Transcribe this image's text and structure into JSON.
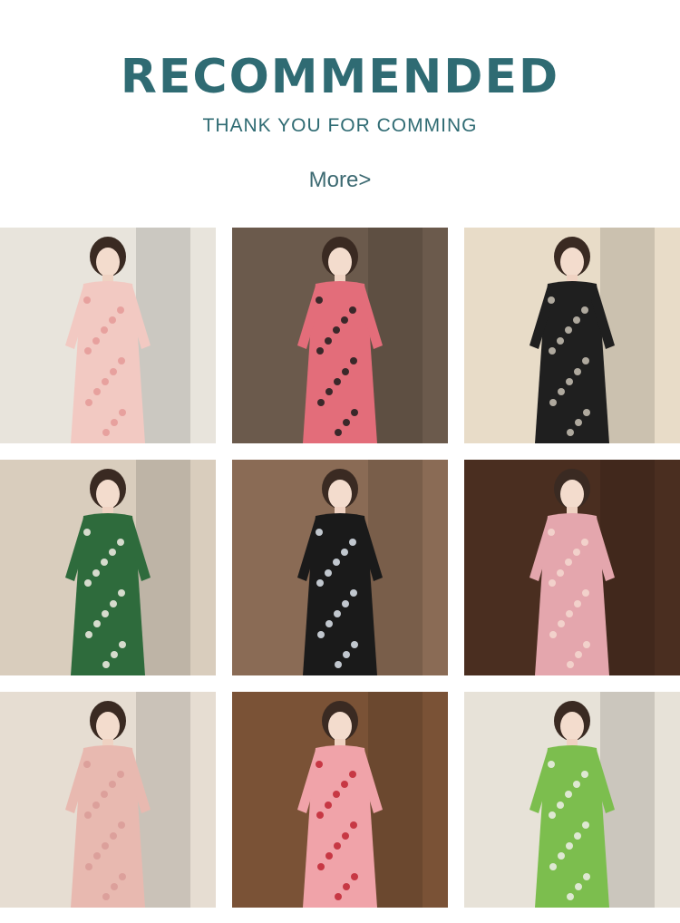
{
  "header": {
    "title": "RECOMMENDED",
    "subtitle": "THANK YOU FOR COMMING",
    "more_label": "More>"
  },
  "colors": {
    "accent": "#2f6b73",
    "background": "#ffffff"
  },
  "products": [
    {
      "name": "pink-floral-qipao-dress-photo",
      "bg": "#e8e4dc",
      "accent": "#f2c9c2",
      "pattern": "#e59a98"
    },
    {
      "name": "pink-blouse-black-skirt-photo",
      "bg": "#6b5a4c",
      "accent": "#e36d7a",
      "pattern": "#1c1c1c"
    },
    {
      "name": "black-brocade-qipao-fur-photo",
      "bg": "#e8dcc8",
      "accent": "#1f1f1f",
      "pattern": "#c9c2b5"
    },
    {
      "name": "green-velvet-lace-collar-dress-photo",
      "bg": "#d9cdbd",
      "accent": "#2e6b3c",
      "pattern": "#f3efe6"
    },
    {
      "name": "black-lace-collar-dress-photo",
      "bg": "#8a6b55",
      "accent": "#1a1a1a",
      "pattern": "#dfe6ef"
    },
    {
      "name": "pink-qipao-sheer-sleeve-photo",
      "bg": "#4a2e20",
      "accent": "#e4a6ad",
      "pattern": "#f4d8d0"
    },
    {
      "name": "pink-floral-qipao-cardigan-photo",
      "bg": "#e6ddd2",
      "accent": "#e8b9b0",
      "pattern": "#d99b98"
    },
    {
      "name": "rose-print-qipao-velvet-jacket-photo",
      "bg": "#7a5236",
      "accent": "#f0a3a9",
      "pattern": "#c02632"
    },
    {
      "name": "green-qipao-top-lily-photo",
      "bg": "#e7e2d8",
      "accent": "#7cbe4e",
      "pattern": "#f0f0ea"
    }
  ]
}
